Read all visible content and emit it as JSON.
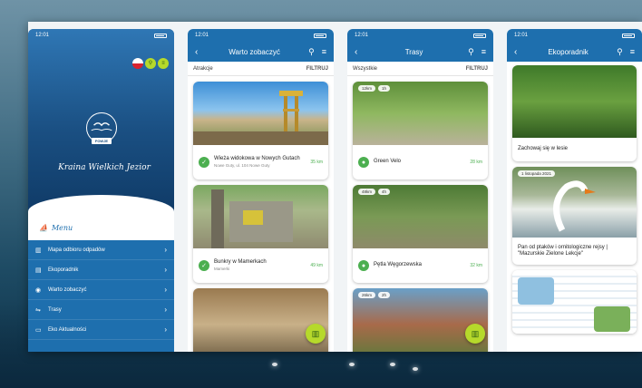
{
  "phone1": {
    "status_time": "12:01",
    "brand_script": "Kraina Wielkich Jezior",
    "badge": "FOWJE",
    "menu_title": "Menu",
    "menu": [
      {
        "label": "Mapa odbioru odpadów",
        "icon": "map-icon"
      },
      {
        "label": "Ekoporadnik",
        "icon": "book-icon"
      },
      {
        "label": "Warto zobaczyć",
        "icon": "pin-icon"
      },
      {
        "label": "Trasy",
        "icon": "route-icon"
      },
      {
        "label": "Eko Aktualności",
        "icon": "news-icon"
      }
    ]
  },
  "phone2": {
    "status_time": "12:01",
    "title": "Warto zobaczyć",
    "tab": "Atrakcje",
    "filter": "FILTRUJ",
    "cards": [
      {
        "title": "Wieża widokowa w Nowych Gutach",
        "sub": "Nowe Guty, ul. 104 Nowe Guty",
        "dist": "35 km"
      },
      {
        "title": "Bunkry w Mamerkach",
        "sub": "Mamerki",
        "dist": "49 km"
      }
    ]
  },
  "phone3": {
    "status_time": "12:01",
    "title": "Trasy",
    "tab": "Wszystkie",
    "filter": "FILTRUJ",
    "cards": [
      {
        "title": "Green Velo",
        "dist": "28 km",
        "tag1": "12km",
        "tag2": "1h"
      },
      {
        "title": "Pętla Węgorzewska",
        "dist": "32 km",
        "tag1": "48km",
        "tag2": "4h"
      },
      {
        "tag1": "26km",
        "tag2": "2h"
      }
    ]
  },
  "phone4": {
    "status_time": "12:01",
    "title": "Ekoporadnik",
    "cards": [
      {
        "title": "Zachowaj się w lesie"
      },
      {
        "date": "1 listopada 2021",
        "title": "Pan od ptaków i ornitologiczne rejsy | \"Mazurskie Zielone Lekcje\""
      }
    ]
  },
  "colors": {
    "brand_blue": "#1e6fae",
    "accent_green": "#b6d92b",
    "distance_green": "#4caf50"
  }
}
